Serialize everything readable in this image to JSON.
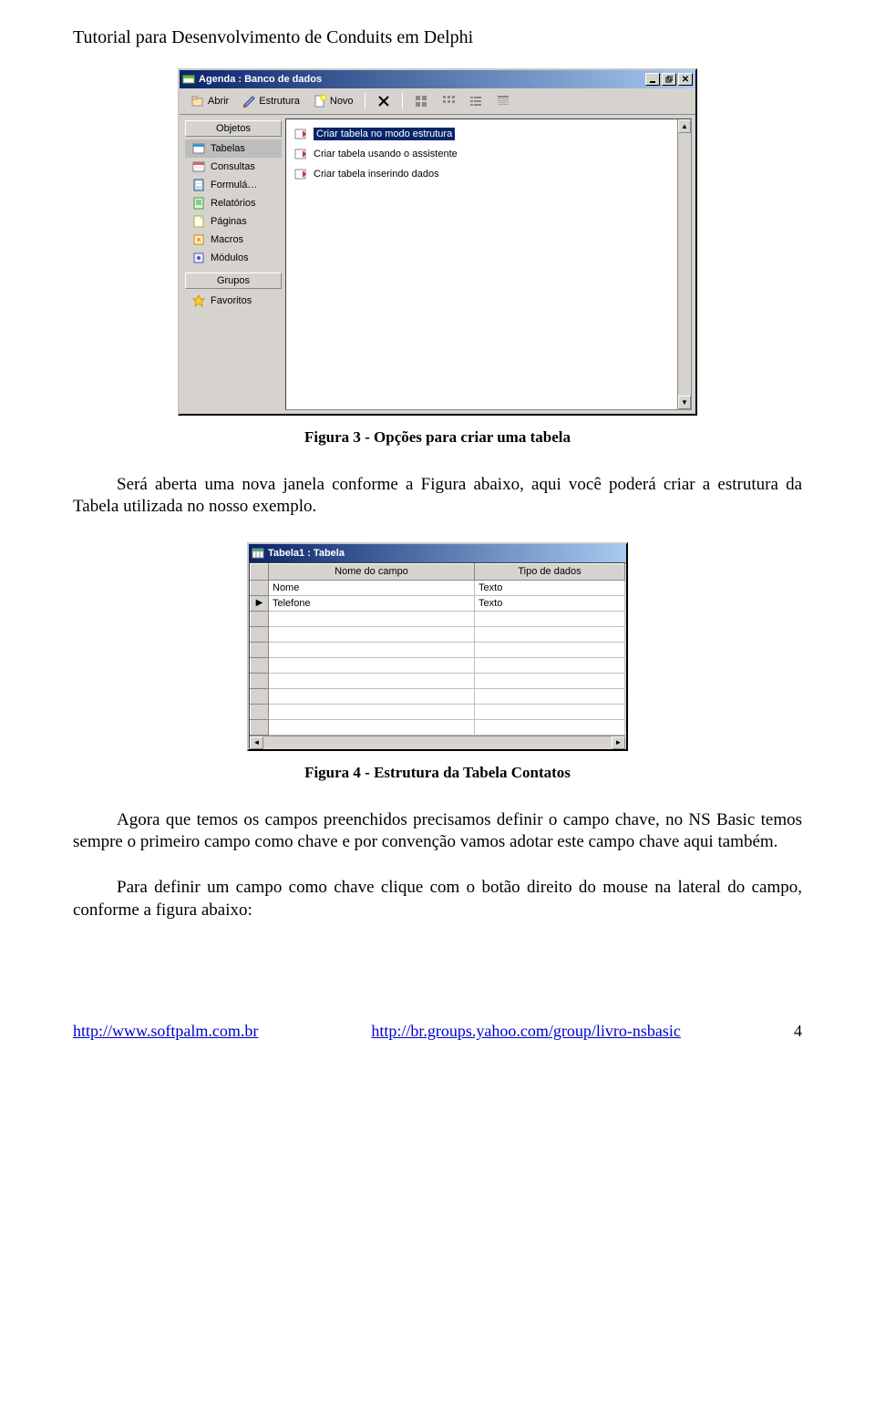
{
  "header": "Tutorial para Desenvolvimento de Conduits em Delphi",
  "screenshot1": {
    "title": "Agenda : Banco de dados",
    "window_icons": {
      "min": "minimize-icon",
      "restore": "restore-icon",
      "close": "close-icon"
    },
    "toolbar": {
      "abrir": "Abrir",
      "estrutura": "Estrutura",
      "novo": "Novo",
      "delete_icon": "delete-icon",
      "view_small": "small-icons",
      "view_large": "large-icons",
      "view_list": "list-icon",
      "view_details": "details-icon"
    },
    "sidebar": {
      "group_objetos": "Objetos",
      "items": [
        {
          "label": "Tabelas",
          "icon": "table-icon",
          "selected": true
        },
        {
          "label": "Consultas",
          "icon": "query-icon",
          "selected": false
        },
        {
          "label": "Formulá…",
          "icon": "form-icon",
          "selected": false
        },
        {
          "label": "Relatórios",
          "icon": "report-icon",
          "selected": false
        },
        {
          "label": "Páginas",
          "icon": "page-icon",
          "selected": false
        },
        {
          "label": "Macros",
          "icon": "macro-icon",
          "selected": false
        },
        {
          "label": "Módulos",
          "icon": "module-icon",
          "selected": false
        }
      ],
      "group_grupos": "Grupos",
      "favoritos": "Favoritos"
    },
    "options": [
      {
        "label": "Criar tabela no modo estrutura",
        "selected": true
      },
      {
        "label": "Criar tabela usando o assistente",
        "selected": false
      },
      {
        "label": "Criar tabela inserindo dados",
        "selected": false
      }
    ]
  },
  "caption1": "Figura 3 - Opções para criar uma tabela",
  "para1": "Será aberta uma nova janela conforme a Figura abaixo, aqui você poderá criar a estrutura da Tabela utilizada no nosso exemplo.",
  "screenshot2": {
    "title": "Tabela1 : Tabela",
    "columns": {
      "name": "Nome do campo",
      "type": "Tipo de dados"
    },
    "rows": [
      {
        "name": "Nome",
        "type": "Texto",
        "marker": ""
      },
      {
        "name": "Telefone",
        "type": "Texto",
        "marker": "▶"
      },
      {
        "name": "",
        "type": "",
        "marker": ""
      },
      {
        "name": "",
        "type": "",
        "marker": ""
      },
      {
        "name": "",
        "type": "",
        "marker": ""
      },
      {
        "name": "",
        "type": "",
        "marker": ""
      },
      {
        "name": "",
        "type": "",
        "marker": ""
      },
      {
        "name": "",
        "type": "",
        "marker": ""
      },
      {
        "name": "",
        "type": "",
        "marker": ""
      },
      {
        "name": "",
        "type": "",
        "marker": ""
      }
    ]
  },
  "caption2": "Figura 4 - Estrutura da Tabela Contatos",
  "para2": "Agora que temos os campos preenchidos precisamos definir o campo chave, no NS Basic temos sempre o primeiro campo como chave e por convenção vamos adotar este campo chave aqui também.",
  "para3": "Para definir um campo como chave clique com o botão direito do mouse na lateral do campo, conforme a figura abaixo:",
  "footer": {
    "link1_text": "http://www.softpalm.com.br",
    "link1_href": "http://www.softpalm.com.br",
    "link2_text": "http://br.groups.yahoo.com/group/livro-nsbasic",
    "link2_href": "http://br.groups.yahoo.com/group/livro-nsbasic",
    "page": "4"
  }
}
